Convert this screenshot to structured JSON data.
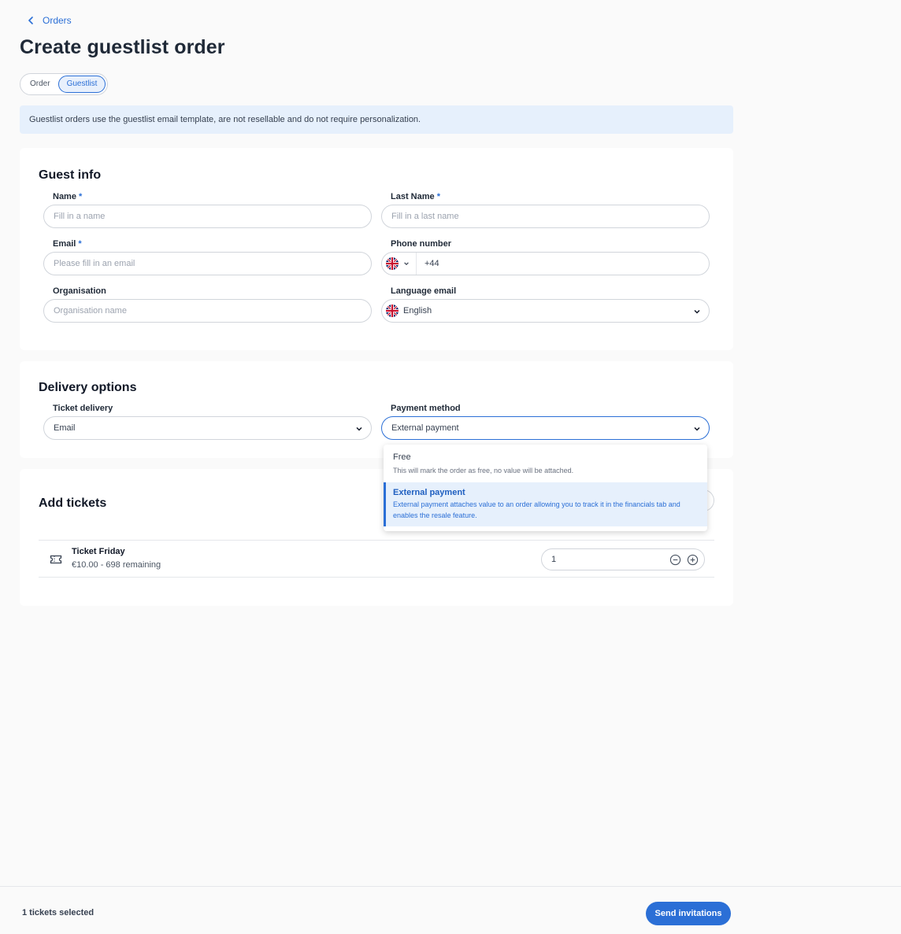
{
  "breadcrumb": {
    "back_label": "Orders"
  },
  "page": {
    "title": "Create guestlist order"
  },
  "order_type_toggle": {
    "options": [
      "Order",
      "Guestlist"
    ],
    "selected": "Guestlist"
  },
  "info_banner": "Guestlist orders use the guestlist email template, are not resellable and do not require personalization.",
  "guest_info": {
    "title": "Guest info",
    "name": {
      "label": "Name",
      "required_mark": "*",
      "placeholder": "Fill in a name"
    },
    "last_name": {
      "label": "Last Name",
      "required_mark": "*",
      "placeholder": "Fill in a last name"
    },
    "email": {
      "label": "Email",
      "required_mark": "*",
      "placeholder": "Please fill in an email"
    },
    "phone": {
      "label": "Phone number",
      "value": "+44"
    },
    "organisation": {
      "label": "Organisation",
      "placeholder": "Organisation name"
    },
    "language_email": {
      "label": "Language email",
      "value": "English"
    }
  },
  "delivery_options": {
    "title": "Delivery options",
    "ticket_delivery": {
      "label": "Ticket delivery",
      "value": "Email"
    },
    "payment_method": {
      "label": "Payment method",
      "value": "External payment",
      "options": [
        {
          "title": "Free",
          "description": "This will mark the order as free, no value will be attached."
        },
        {
          "title": "External payment",
          "description": "External payment attaches value to an order allowing you to track it in the financials tab and enables the resale feature."
        }
      ]
    }
  },
  "add_tickets": {
    "title": "Add tickets",
    "tickets": [
      {
        "name": "Ticket Friday",
        "meta": "€10.00 - 698 remaining",
        "quantity": "1"
      }
    ]
  },
  "footer": {
    "selected_count": "1 tickets selected",
    "send_label": "Send invitations"
  },
  "colors": {
    "accent": "#2b6fd6",
    "banner_bg": "#e6f0fc",
    "page_bg": "#fafafa"
  },
  "icons": {
    "back": "chevron-left-icon",
    "flag": "uk-flag-icon",
    "ticket": "ticket-icon",
    "minus": "minus-circle-icon",
    "plus": "plus-circle-icon"
  }
}
